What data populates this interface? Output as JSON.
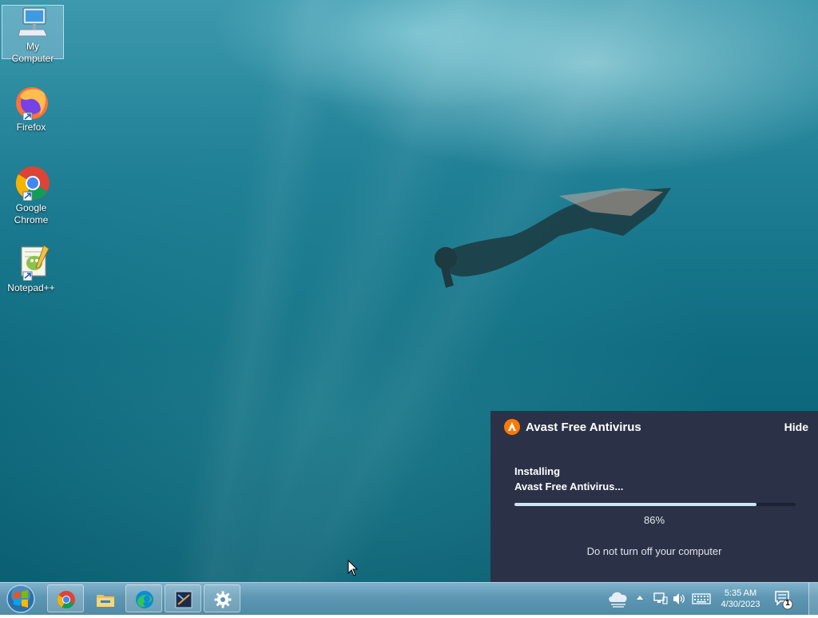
{
  "desktop": {
    "icons": [
      {
        "label": "My Computer"
      },
      {
        "label": "Firefox"
      },
      {
        "label": "Google Chrome"
      },
      {
        "label": "Notepad++"
      }
    ]
  },
  "avast_popup": {
    "title": "Avast Free Antivirus",
    "hide_label": "Hide",
    "status_line1": "Installing",
    "status_line2": "Avast Free Antivirus...",
    "progress": 0.86,
    "progress_label": "86%",
    "note": "Do not turn off your computer",
    "colors": {
      "background": "#2b3247",
      "accent": "#ff7800",
      "progress_fill": "#cfe4f5"
    }
  },
  "taskbar": {
    "pinned": [
      {
        "icon": "chrome-icon"
      },
      {
        "icon": "file-explorer-icon"
      },
      {
        "icon": "edge-icon"
      },
      {
        "icon": "terminal-app-icon"
      },
      {
        "icon": "settings-gear-icon"
      }
    ],
    "tray": {
      "time": "5:35 AM",
      "date": "4/30/2023",
      "notification_count": "1"
    }
  }
}
